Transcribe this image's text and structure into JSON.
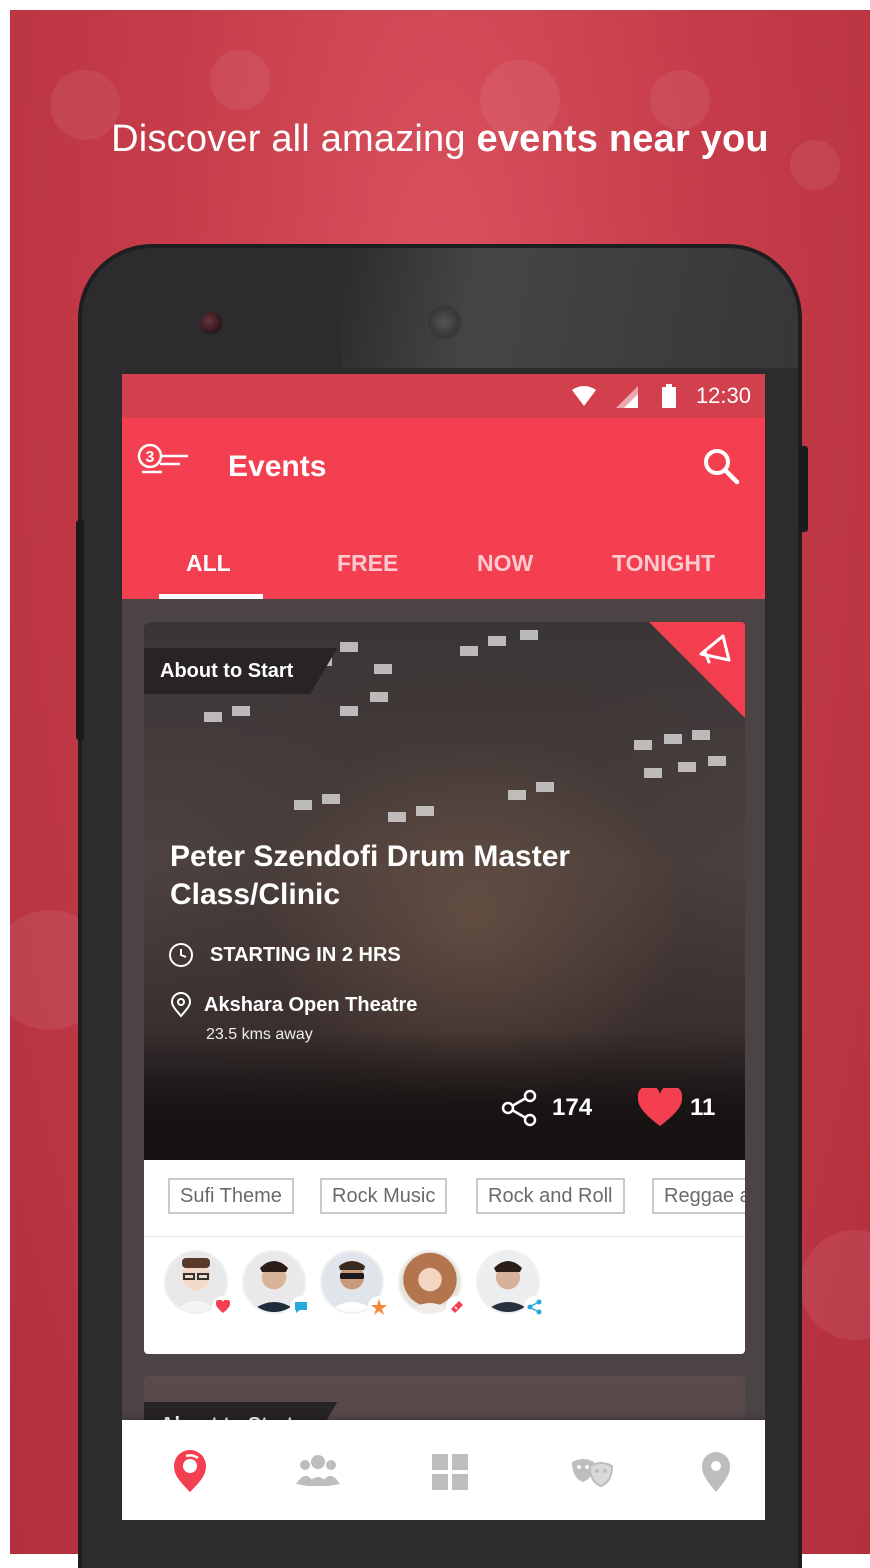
{
  "promo": {
    "headline_regular": "Discover all amazing ",
    "headline_bold": "events near you"
  },
  "status_bar": {
    "time": "12:30"
  },
  "app_bar": {
    "title": "Events",
    "menu_badge": "3",
    "icons": [
      "menu-icon",
      "search-icon"
    ]
  },
  "tabs": [
    {
      "label": "ALL",
      "active": true
    },
    {
      "label": "FREE",
      "active": false
    },
    {
      "label": "NOW",
      "active": false
    },
    {
      "label": "TONIGHT",
      "active": false
    }
  ],
  "event_card": {
    "badge": "About to Start",
    "corner_icon": "promote-icon",
    "title": "Peter Szendofi Drum Master Class/Clinic",
    "time": "STARTING IN 2 HRS",
    "venue": "Akshara Open Theatre",
    "distance": "23.5 kms away",
    "shares": "174",
    "likes": "11",
    "tags": [
      "Sufi Theme",
      "Rock Music",
      "Rock and Roll",
      "Reggae a"
    ],
    "attendees": [
      {
        "status_icon": "heart-icon",
        "status_color": "#f43f50"
      },
      {
        "status_icon": "comment-icon",
        "status_color": "#29a8e0"
      },
      {
        "status_icon": "star-icon",
        "status_color": "#f5883a"
      },
      {
        "status_icon": "ticket-icon",
        "status_color": "#f43f50"
      },
      {
        "status_icon": "share-icon",
        "status_color": "#29a8e0"
      }
    ]
  },
  "next_card": {
    "badge": "About to Start"
  },
  "bottom_nav": [
    {
      "icon": "events-pin-icon",
      "active": true
    },
    {
      "icon": "people-icon",
      "active": false
    },
    {
      "icon": "grid-icon",
      "active": false
    },
    {
      "icon": "theatre-masks-icon",
      "active": false
    },
    {
      "icon": "location-icon",
      "active": false
    }
  ],
  "colors": {
    "brand": "#f43f50",
    "background": "#c63c4a"
  }
}
